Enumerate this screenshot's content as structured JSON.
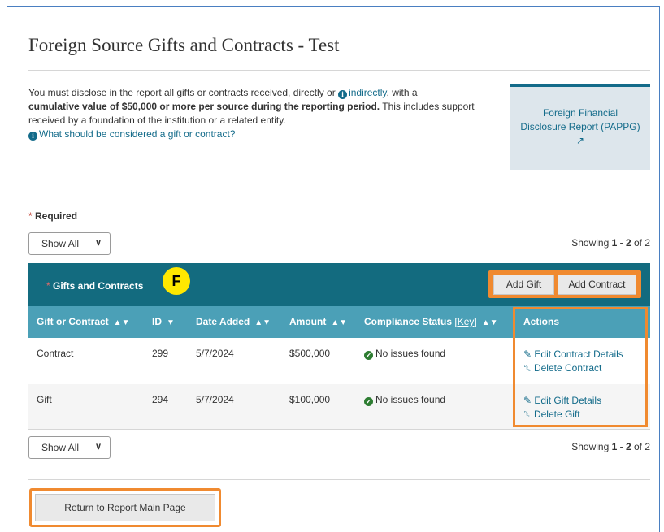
{
  "page": {
    "title": "Foreign Source Gifts and Contracts - Test"
  },
  "intro": {
    "line1_a": "You must disclose in the report all gifts or contracts received, directly or ",
    "line1_link": "indirectly",
    "line1_b": ", with a",
    "bold_text": "cumulative value of $50,000 or more per source during the reporting period.",
    "rest": " This includes support received by a foundation of the institution or a related entity.",
    "help_link": "What should be considered a gift or contract?"
  },
  "sidebar_link": {
    "label": "Foreign Financial Disclosure Report (PAPPG)"
  },
  "required_label": "Required",
  "pagination": {
    "select_value": "Show All",
    "showing_prefix": "Showing ",
    "range": "1 - 2",
    "of_text": " of 2"
  },
  "table": {
    "title": "Gifts and Contracts",
    "annotation_badge": "F",
    "add_gift_label": "Add Gift",
    "add_contract_label": "Add Contract",
    "columns": {
      "type": "Gift or Contract",
      "id": "ID",
      "date": "Date Added",
      "amount": "Amount",
      "status": "Compliance Status",
      "status_key": "[Key]",
      "actions": "Actions"
    },
    "rows": [
      {
        "type": "Contract",
        "id": "299",
        "date": "5/7/2024",
        "amount": "$500,000",
        "status": "No issues found",
        "edit_label": "Edit Contract Details",
        "delete_label": "Delete Contract"
      },
      {
        "type": "Gift",
        "id": "294",
        "date": "5/7/2024",
        "amount": "$100,000",
        "status": "No issues found",
        "edit_label": "Edit Gift Details",
        "delete_label": "Delete Gift"
      }
    ]
  },
  "return_button": "Return to Report Main Page",
  "colors": {
    "header_teal": "#136b7f",
    "column_teal": "#4ba0b7",
    "link_teal": "#136b8a",
    "highlight_orange": "#f08a30",
    "badge_yellow": "#ffe800"
  }
}
